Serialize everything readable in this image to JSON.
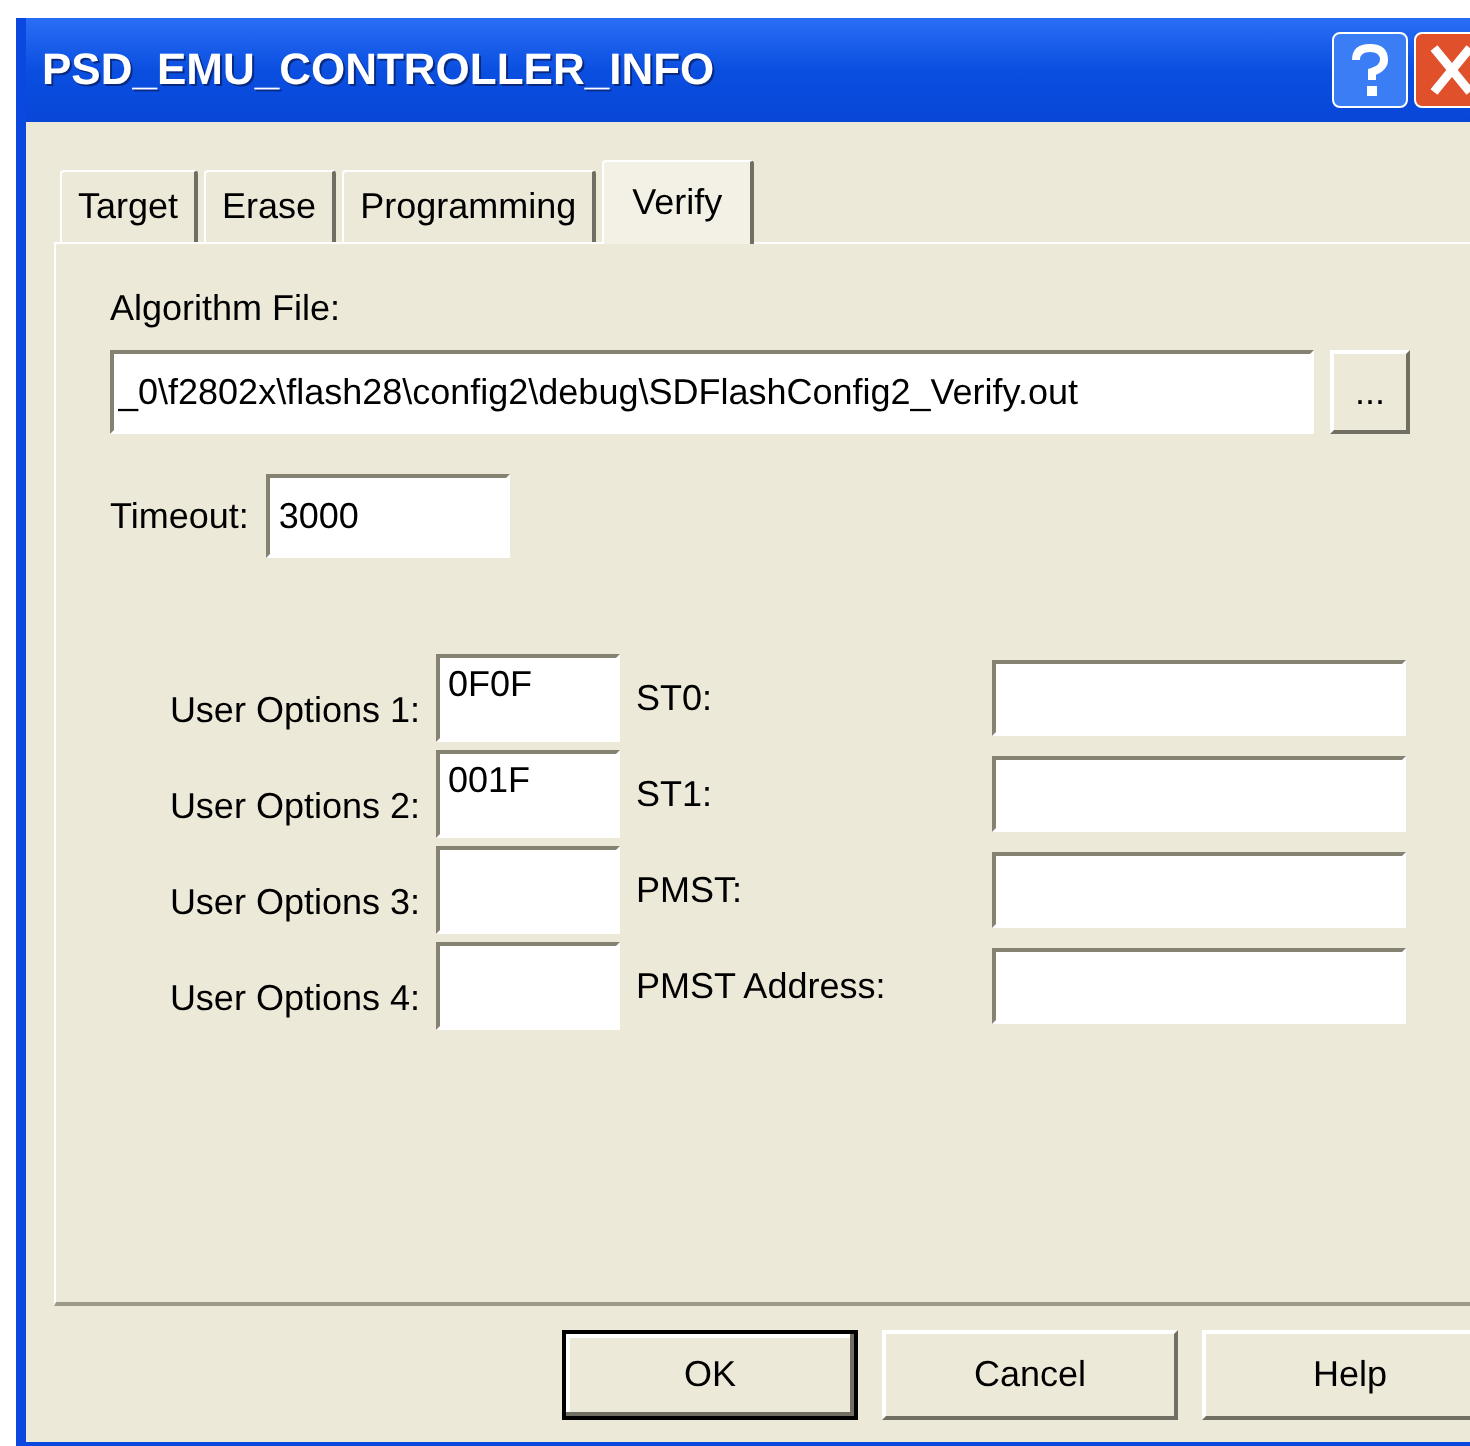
{
  "window": {
    "title": "PSD_EMU_CONTROLLER_INFO"
  },
  "tabs": [
    {
      "label": "Target",
      "selected": false
    },
    {
      "label": "Erase",
      "selected": false
    },
    {
      "label": "Programming",
      "selected": false
    },
    {
      "label": "Verify",
      "selected": true
    }
  ],
  "algorithm_file": {
    "label": "Algorithm File:",
    "value": "_0\\f2802x\\flash28\\config2\\debug\\SDFlashConfig2_Verify.out",
    "browse_button": "..."
  },
  "timeout": {
    "label": "Timeout:",
    "value": "3000"
  },
  "user_options": [
    {
      "label": "User Options 1:",
      "value": "0F0F"
    },
    {
      "label": "User Options 2:",
      "value": "001F"
    },
    {
      "label": "User Options 3:"
    },
    {
      "label": "User Options 4:"
    }
  ],
  "registers": [
    {
      "label": "ST0:"
    },
    {
      "label": "ST1:"
    },
    {
      "label": "PMST:"
    },
    {
      "label": "PMST Address:"
    }
  ],
  "buttons": [
    {
      "label": "OK",
      "default": true
    },
    {
      "label": "Cancel",
      "default": false
    },
    {
      "label": "Help",
      "default": false
    }
  ]
}
